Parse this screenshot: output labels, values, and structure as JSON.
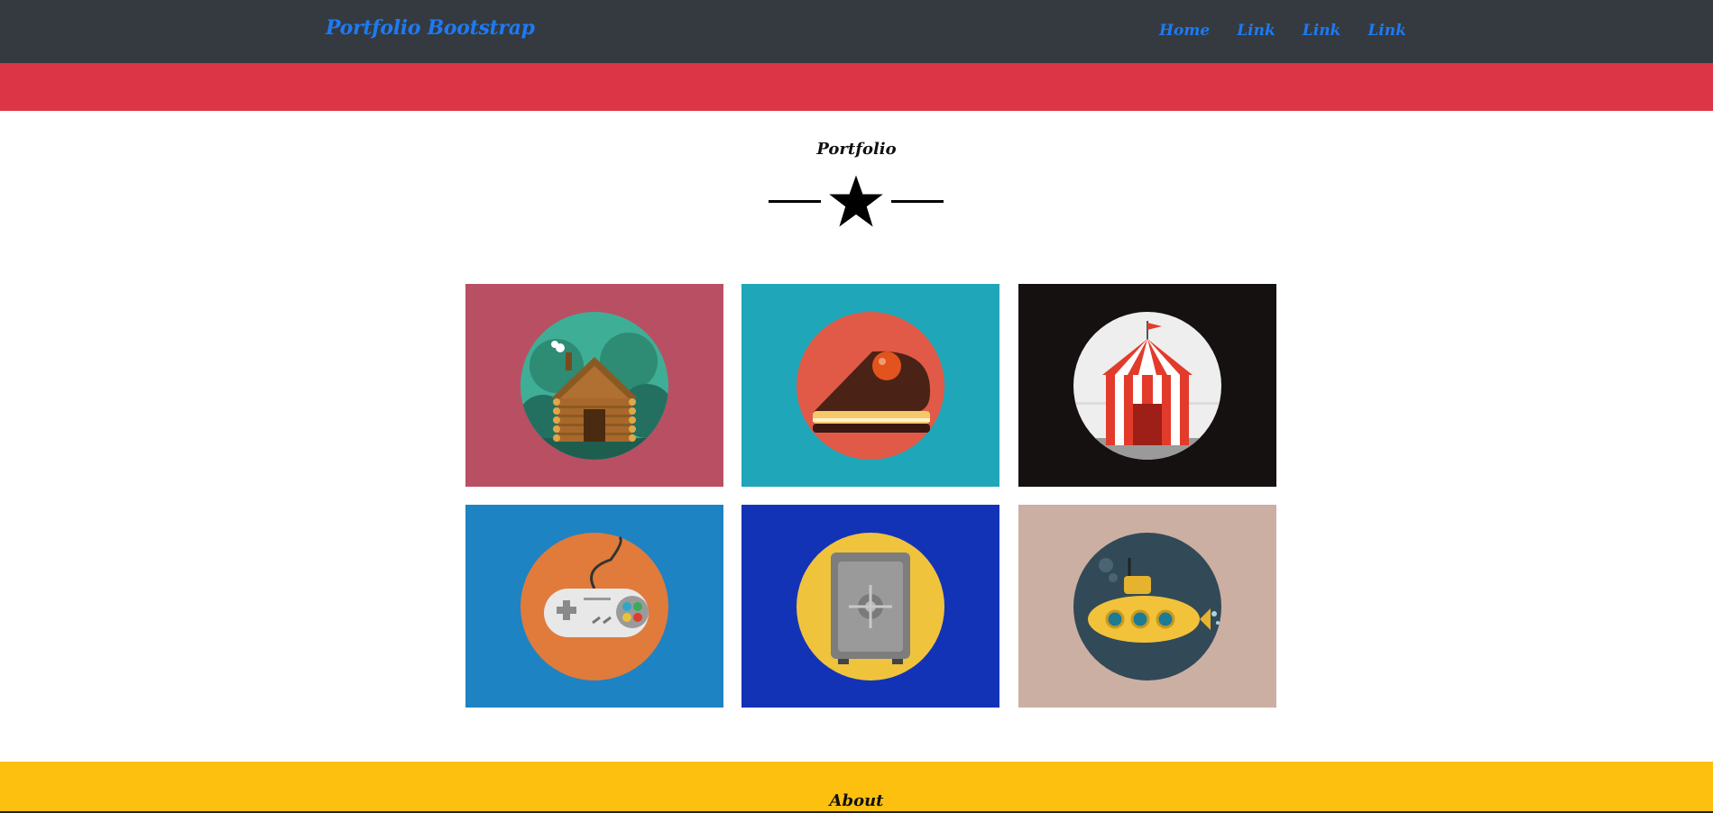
{
  "navbar": {
    "brand": "Portfolio Bootstrap",
    "links": [
      "Home",
      "Link",
      "Link",
      "Link"
    ]
  },
  "colors": {
    "navbar_bg": "#343a40",
    "link": "#1d7af3",
    "accent_bar": "#dc3545",
    "footer_band": "#fdc00f"
  },
  "portfolio": {
    "title": "Portfolio",
    "divider_icon": "star-icon",
    "items": [
      {
        "icon": "log-cabin-icon",
        "bg": "#b94f63",
        "circle": "#3fae96"
      },
      {
        "icon": "cake-slice-icon",
        "bg": "#1fa6b8",
        "circle": "#e05a47"
      },
      {
        "icon": "circus-tent-icon",
        "bg": "#141110",
        "circle": "#eeeeee"
      },
      {
        "icon": "game-controller-icon",
        "bg": "#1e83c2",
        "circle": "#e07b3b"
      },
      {
        "icon": "safe-icon",
        "bg": "#1333b7",
        "circle": "#f0c33c"
      },
      {
        "icon": "submarine-icon",
        "bg": "#ccafa3",
        "circle": "#324a57"
      }
    ]
  },
  "about": {
    "title": "About"
  }
}
